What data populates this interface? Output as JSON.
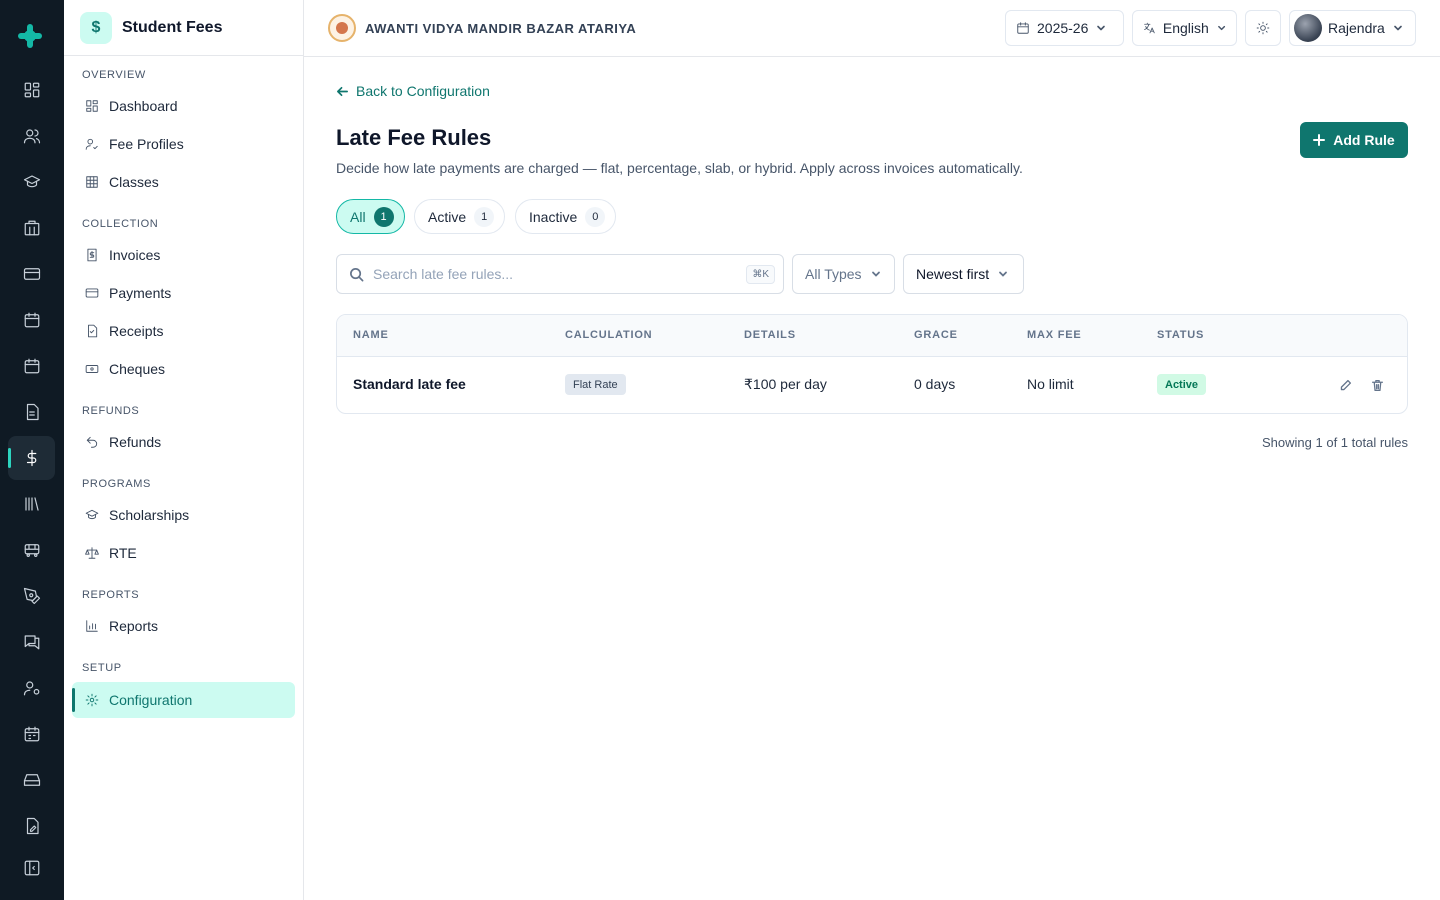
{
  "app": {
    "title": "Student Fees",
    "badge_symbol": "$"
  },
  "school": {
    "name": "AWANTI VIDYA MANDIR BAZAR ATARIYA"
  },
  "topbar": {
    "year": "2025-26",
    "language": "English",
    "user": "Rajendra"
  },
  "sidebar": {
    "sections": [
      {
        "label": "OVERVIEW",
        "items": [
          {
            "label": "Dashboard",
            "icon": "dashboard-icon"
          },
          {
            "label": "Fee Profiles",
            "icon": "user-check-icon"
          },
          {
            "label": "Classes",
            "icon": "table-icon"
          }
        ]
      },
      {
        "label": "COLLECTION",
        "items": [
          {
            "label": "Invoices",
            "icon": "invoice-icon"
          },
          {
            "label": "Payments",
            "icon": "credit-card-icon"
          },
          {
            "label": "Receipts",
            "icon": "receipt-icon"
          },
          {
            "label": "Cheques",
            "icon": "cheque-icon"
          }
        ]
      },
      {
        "label": "REFUNDS",
        "items": [
          {
            "label": "Refunds",
            "icon": "undo-icon"
          }
        ]
      },
      {
        "label": "PROGRAMS",
        "items": [
          {
            "label": "Scholarships",
            "icon": "graduation-cap-icon"
          },
          {
            "label": "RTE",
            "icon": "scale-icon"
          }
        ]
      },
      {
        "label": "REPORTS",
        "items": [
          {
            "label": "Reports",
            "icon": "bar-chart-icon"
          }
        ]
      },
      {
        "label": "SETUP",
        "items": [
          {
            "label": "Configuration",
            "icon": "gear-icon",
            "active": true
          }
        ]
      }
    ]
  },
  "page": {
    "back_link": "Back to Configuration",
    "title": "Late Fee Rules",
    "subtitle": "Decide how late payments are charged — flat, percentage, slab, or hybrid. Apply across invoices automatically.",
    "add_button": "Add Rule"
  },
  "filters": {
    "pills": [
      {
        "label": "All",
        "count": "1",
        "active": true
      },
      {
        "label": "Active",
        "count": "1"
      },
      {
        "label": "Inactive",
        "count": "0"
      }
    ],
    "search_placeholder": "Search late fee rules...",
    "search_shortcut": "⌘K",
    "type_select": "All Types",
    "sort_select": "Newest first"
  },
  "table": {
    "columns": [
      "NAME",
      "CALCULATION",
      "DETAILS",
      "GRACE",
      "MAX FEE",
      "STATUS"
    ],
    "rows": [
      {
        "name": "Standard late fee",
        "calculation": "Flat Rate",
        "details": "₹100 per day",
        "grace": "0 days",
        "max_fee": "No limit",
        "status": "Active"
      }
    ]
  },
  "footer": {
    "summary": "Showing 1 of 1 total rules"
  },
  "colors": {
    "accent": "#0f766e",
    "accent_soft": "#ccfbf1",
    "rail_bg": "#0f1a24",
    "status_active": "#047857"
  }
}
